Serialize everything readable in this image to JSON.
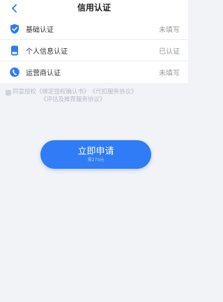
{
  "header": {
    "title": "信用认证",
    "back_icon": "chevron-left-icon"
  },
  "items": [
    {
      "label": "基础认证",
      "status": "未填写",
      "icon": "shield-check-icon"
    },
    {
      "label": "个人信息认证",
      "status": "已认证",
      "icon": "phone-device-icon"
    },
    {
      "label": "运营商认证",
      "status": "未填写",
      "icon": "phone-handset-icon"
    }
  ],
  "agreement": {
    "prefix": "同意授权",
    "links": [
      "《绑定授权确认书》",
      "《代扣服务协议》",
      "《评估及推荐服务协议》"
    ]
  },
  "apply_button": {
    "label": "立即申请",
    "sub_label": "需273元"
  },
  "colors": {
    "accent": "#2f7cf6",
    "background": "#f2f3f7"
  }
}
